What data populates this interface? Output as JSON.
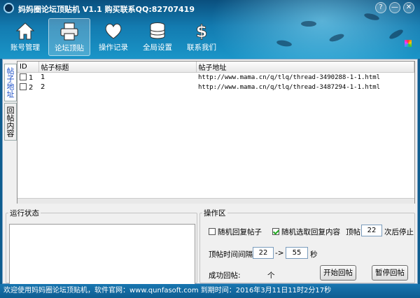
{
  "window": {
    "title": "妈妈圈论坛顶贴机 V1.1 购买联系QQ:82707419",
    "controls": [
      "?",
      "—",
      "✕"
    ]
  },
  "toolbar": [
    {
      "label": "账号管理",
      "icon": "home-icon",
      "active": false
    },
    {
      "label": "论坛顶贴",
      "icon": "printer-icon",
      "active": true
    },
    {
      "label": "操作记录",
      "icon": "heart-icon",
      "active": false
    },
    {
      "label": "全局设置",
      "icon": "database-icon",
      "active": false
    },
    {
      "label": "联系我们",
      "icon": "dollar-icon",
      "active": false
    }
  ],
  "side_tabs": [
    "帖子地址",
    "回帖内容"
  ],
  "grid": {
    "columns": [
      "ID",
      "帖子标题",
      "帖子地址"
    ],
    "rows": [
      {
        "id": "1",
        "title": "1",
        "url": "http://www.mama.cn/q/tlq/thread-3490288-1-1.html"
      },
      {
        "id": "2",
        "title": "2",
        "url": "http://www.mama.cn/q/tlq/thread-3487294-1-1.html"
      }
    ]
  },
  "status_panel": {
    "legend": "运行状态"
  },
  "ops": {
    "legend": "操作区",
    "random_reply_label": "随机回复帖子",
    "random_reply_checked": false,
    "random_content_label": "随机选取回复内容",
    "random_content_checked": true,
    "bump_label": "顶帖",
    "bump_count": "22",
    "bump_suffix": "次后停止",
    "interval_label": "顶帖时间间隔",
    "interval_from": "22",
    "interval_arrow": "->",
    "interval_to": "55",
    "interval_unit": "秒",
    "success_label": "成功回帖:",
    "success_unit": "个",
    "start_button": "开始回帖",
    "stop_button": "暂停回帖"
  },
  "statusbar": {
    "text": "欢迎使用妈妈圈论坛顶贴机，软件官网：www.qunfasoft.com 到期时间：2016年3月11日11时2分17秒"
  }
}
